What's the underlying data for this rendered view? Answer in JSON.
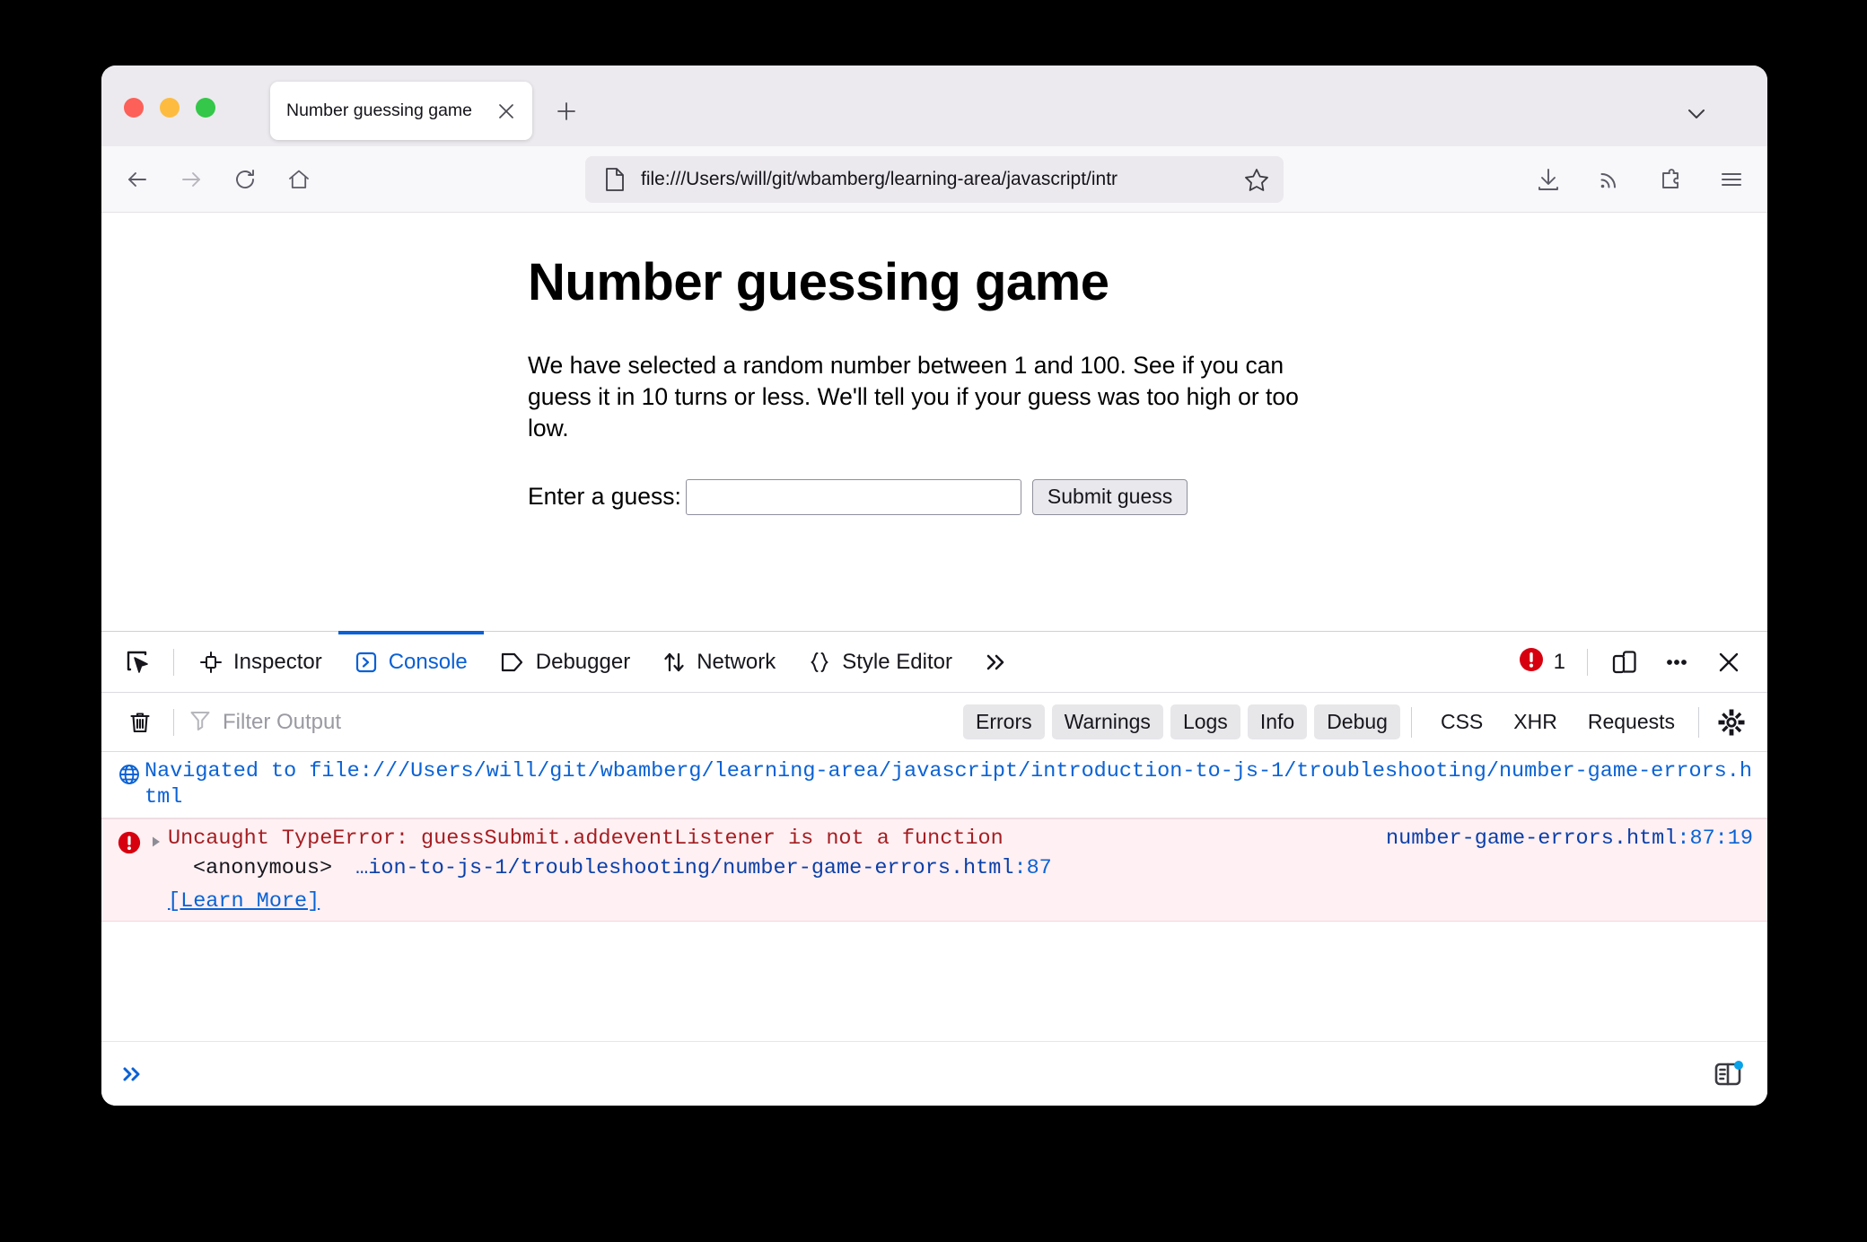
{
  "browser": {
    "traffic_lights": [
      "close",
      "minimize",
      "zoom"
    ],
    "tab": {
      "title": "Number guessing game",
      "close_icon": "close-icon"
    },
    "new_tab_label": "+",
    "toolbar": {
      "back_icon": "back-arrow-icon",
      "forward_icon": "forward-arrow-icon",
      "reload_icon": "reload-icon",
      "home_icon": "home-icon",
      "url": "file:///Users/will/git/wbamberg/learning-area/javascript/intr",
      "bookmark_icon": "star-icon",
      "downloads_icon": "download-icon",
      "rss_icon": "rss-icon",
      "extensions_icon": "extensions-icon",
      "menu_icon": "hamburger-menu-icon"
    }
  },
  "page": {
    "title": "Number guessing game",
    "paragraph": "We have selected a random number between 1 and 100. See if you can guess it in 10 turns or less. We'll tell you if your guess was too high or too low.",
    "form": {
      "label": "Enter a guess:",
      "input_value": "",
      "input_placeholder": "",
      "submit_label": "Submit guess"
    }
  },
  "devtools": {
    "picker_icon": "element-picker-icon",
    "tabs": [
      {
        "label": "Inspector",
        "icon": "inspector-icon",
        "active": false
      },
      {
        "label": "Console",
        "icon": "console-chevron-icon",
        "active": true
      },
      {
        "label": "Debugger",
        "icon": "debugger-icon",
        "active": false
      },
      {
        "label": "Network",
        "icon": "network-arrows-icon",
        "active": false
      },
      {
        "label": "Style Editor",
        "icon": "braces-icon",
        "active": false
      }
    ],
    "overflow_tabs_icon": "double-chevron-right-icon",
    "error_badge": {
      "icon": "error-circle-icon",
      "count": "1",
      "color": "#d7000f"
    },
    "responsive_icon": "responsive-design-mode-icon",
    "meatball_icon": "meatball-menu-icon",
    "close_icon": "close-icon",
    "active_tab_color": "#0a60d4",
    "filter_bar": {
      "clear_icon": "trash-icon",
      "filter_icon": "funnel-icon",
      "filter_placeholder": "Filter Output",
      "filter_value": "",
      "pills": [
        "Errors",
        "Warnings",
        "Logs",
        "Info",
        "Debug"
      ],
      "plain_filters": [
        "CSS",
        "XHR",
        "Requests"
      ],
      "settings_icon": "gear-icon"
    },
    "messages": [
      {
        "type": "navigation",
        "icon": "globe-icon",
        "text": "Navigated to file:///Users/will/git/wbamberg/learning-area/javascript/introduction-to-js-1/troubleshooting/number-game-errors.html"
      },
      {
        "type": "error",
        "icon": "error-circle-icon",
        "expander_icon": "triangle-right-icon",
        "text": "Uncaught TypeError: guessSubmit.addeventListener is not a function",
        "source": "number-game-errors.html",
        "source_line": ":87:19",
        "stack_function": "<anonymous>",
        "stack_location": "…ion-to-js-1/troubleshooting/number-game-errors.html",
        "stack_line": ":87",
        "learn_more": "[Learn More]"
      }
    ],
    "prompt": {
      "chevron_icon": "double-chevron-right-icon",
      "input_value": "",
      "editor_toggle_icon": "split-console-editor-icon",
      "editor_toggle_badge_color": "#0aa2e8"
    }
  }
}
